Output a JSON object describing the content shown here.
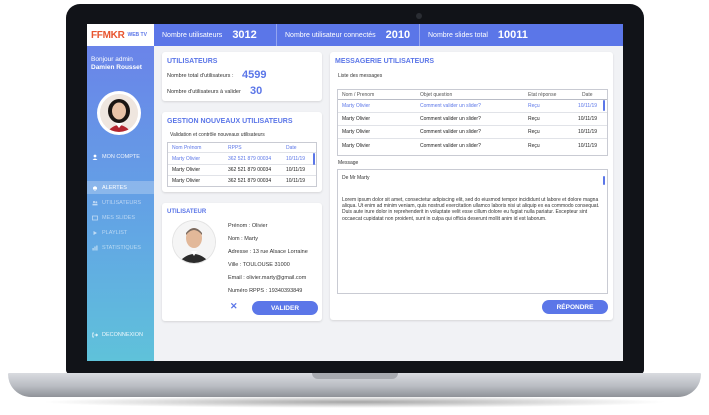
{
  "brand": {
    "logo": "FFMKR",
    "sub": "WEB TV"
  },
  "stats": [
    {
      "label": "Nombre utilisateurs",
      "value": "3012"
    },
    {
      "label": "Nombre utilisateur connectés",
      "value": "2010"
    },
    {
      "label": "Nombre slides total",
      "value": "10011"
    }
  ],
  "sidebar": {
    "greeting": "Bonjour admin",
    "name": "Damien Rousset",
    "items": [
      {
        "label": "MON COMPTE",
        "icon": "user-icon"
      },
      {
        "label": "ALERTES",
        "icon": "bell-icon"
      },
      {
        "label": "UTILISATEURS",
        "icon": "users-icon"
      },
      {
        "label": "MES SLIDES",
        "icon": "slides-icon"
      },
      {
        "label": "PLAYLIST",
        "icon": "playlist-icon"
      },
      {
        "label": "STATISTIQUES",
        "icon": "stats-icon"
      },
      {
        "label": "DECONNEXION",
        "icon": "logout-icon"
      }
    ]
  },
  "users": {
    "title": "UTILISATEURS",
    "total_label": "Nombre total d'utilisateurs :",
    "total_value": "4599",
    "pending_label": "Nombre d'utilisateurs à valider",
    "pending_value": "30"
  },
  "new_users": {
    "title": "GESTION NOUVEAUX UTILISATEURS",
    "subtitle": "Validation et contrôle nouveaux utilisateurs",
    "columns": [
      "Nom Prénom",
      "RPPS",
      "Date"
    ],
    "rows": [
      [
        "Marty Olivier",
        "362 521 879 00034",
        "10/11/19"
      ],
      [
        "Marty Olivier",
        "362 521 879 00034",
        "10/11/19"
      ],
      [
        "Marty Olivier",
        "362 521 879 00034",
        "10/11/19"
      ]
    ]
  },
  "user_detail": {
    "title": "UTILISATEUR",
    "fields": [
      "Prénom : Olivier",
      "Nom : Marty",
      "Adresse : 13 rue Alsace Lorraine",
      "Ville : TOULOUSE 31000",
      "Email : olivier.marty@gmail.com",
      "Numéro RPPS : 19340393849"
    ],
    "reject": "✕",
    "validate": "VALIDER"
  },
  "messages": {
    "title": "MESSAGERIE UTILISATEURS",
    "list_label": "Liste des messages",
    "columns": [
      "Nom / Prenom",
      "Objet question",
      "Etat réponse",
      "Date"
    ],
    "rows": [
      [
        "Marty Olivier",
        "Comment valider un slider?",
        "Reçu",
        "10/11/19"
      ],
      [
        "Marty Olivier",
        "Comment valider un slider?",
        "Reçu",
        "10/11/19"
      ],
      [
        "Marty Olivier",
        "Comment valider un slider?",
        "Reçu",
        "10/11/19"
      ],
      [
        "Marty Olivier",
        "Comment valider un slider?",
        "Reçu",
        "10/11/19"
      ]
    ],
    "message_label": "Message",
    "from": "De Mr Marty",
    "body": "Lorem ipsum dolor sit amet, consectetur adipiscing elit, sed do eiusmod tempor incididunt ut labore et dolore magna aliqua. Ut enim ad minim veniam, quis nostrud exercitation ullamco laboris nisi ut aliquip ex ea commodo consequat. Duis aute irure dolor in reprehenderit in voluptate velit esse cillum dolore eu fugiat nulla pariatur. Excepteur sint occaecat cupidatat non proident, sunt in culpa qui officia deserunt mollit anim id est laborum.",
    "reply": "RÉPONDRE"
  },
  "colors": {
    "accent": "#5b76e8",
    "brand": "#e8552f"
  }
}
